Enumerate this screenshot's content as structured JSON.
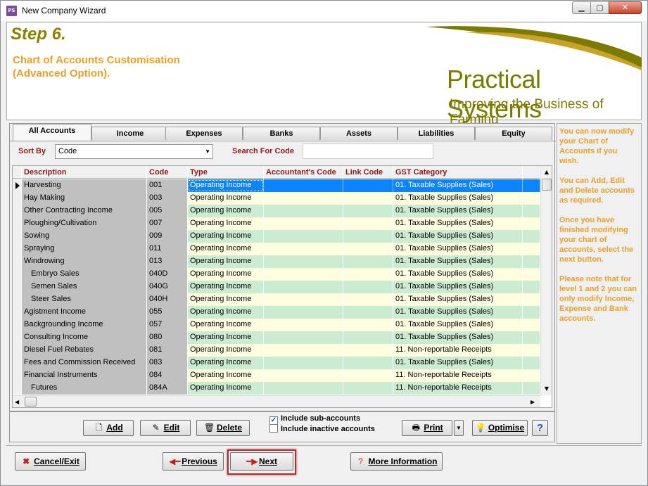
{
  "window": {
    "title": "New Company Wizard",
    "app_icon_text": "PS"
  },
  "header": {
    "step": "Step 6.",
    "subtitle_line1": "Chart of Accounts Customisation",
    "subtitle_line2": "(Advanced Option).",
    "brand_name": "Practical Systems",
    "brand_tagline": "Improving the Business of Farming",
    "brand_color": "#7b7b00",
    "accent_color": "#e8a02a"
  },
  "tabs": [
    "All Accounts",
    "Income",
    "Expenses",
    "Banks",
    "Assets",
    "Liabilities",
    "Equity"
  ],
  "active_tab": "All Accounts",
  "filters": {
    "sort_label": "Sort By",
    "sort_value": "Code",
    "search_label": "Search For Code",
    "search_value": ""
  },
  "grid": {
    "columns": [
      "Description",
      "Code",
      "Type",
      "Accountant's Code",
      "Link Code",
      "GST Category"
    ],
    "rows": [
      {
        "desc": "Harvesting",
        "code": "001",
        "type": "Operating Income",
        "acc": "",
        "link": "",
        "gst": "01. Taxable Supplies (Sales)",
        "sub": false
      },
      {
        "desc": "Hay Making",
        "code": "003",
        "type": "Operating Income",
        "acc": "",
        "link": "",
        "gst": "01. Taxable Supplies (Sales)",
        "sub": false
      },
      {
        "desc": "Other Contracting Income",
        "code": "005",
        "type": "Operating Income",
        "acc": "",
        "link": "",
        "gst": "01. Taxable Supplies (Sales)",
        "sub": false
      },
      {
        "desc": "Ploughing/Cultivation",
        "code": "007",
        "type": "Operating Income",
        "acc": "",
        "link": "",
        "gst": "01. Taxable Supplies (Sales)",
        "sub": false
      },
      {
        "desc": "Sowing",
        "code": "009",
        "type": "Operating Income",
        "acc": "",
        "link": "",
        "gst": "01. Taxable Supplies (Sales)",
        "sub": false
      },
      {
        "desc": "Spraying",
        "code": "011",
        "type": "Operating Income",
        "acc": "",
        "link": "",
        "gst": "01. Taxable Supplies (Sales)",
        "sub": false
      },
      {
        "desc": "Windrowing",
        "code": "013",
        "type": "Operating Income",
        "acc": "",
        "link": "",
        "gst": "01. Taxable Supplies (Sales)",
        "sub": false
      },
      {
        "desc": "Embryo Sales",
        "code": "040D",
        "type": "Operating Income",
        "acc": "",
        "link": "",
        "gst": "01. Taxable Supplies (Sales)",
        "sub": true
      },
      {
        "desc": "Semen Sales",
        "code": "040G",
        "type": "Operating Income",
        "acc": "",
        "link": "",
        "gst": "01. Taxable Supplies (Sales)",
        "sub": true
      },
      {
        "desc": "Steer Sales",
        "code": "040H",
        "type": "Operating Income",
        "acc": "",
        "link": "",
        "gst": "01. Taxable Supplies (Sales)",
        "sub": true
      },
      {
        "desc": "Agistment Income",
        "code": "055",
        "type": "Operating Income",
        "acc": "",
        "link": "",
        "gst": "01. Taxable Supplies (Sales)",
        "sub": false
      },
      {
        "desc": "Backgrounding Income",
        "code": "057",
        "type": "Operating Income",
        "acc": "",
        "link": "",
        "gst": "01. Taxable Supplies (Sales)",
        "sub": false
      },
      {
        "desc": "Consulting Income",
        "code": "080",
        "type": "Operating Income",
        "acc": "",
        "link": "",
        "gst": "01. Taxable Supplies (Sales)",
        "sub": false
      },
      {
        "desc": "Diesel Fuel Rebates",
        "code": "081",
        "type": "Operating Income",
        "acc": "",
        "link": "",
        "gst": "11. Non-reportable Receipts",
        "sub": false
      },
      {
        "desc": "Fees and Commission Received",
        "code": "083",
        "type": "Operating Income",
        "acc": "",
        "link": "",
        "gst": "01. Taxable Supplies (Sales)",
        "sub": false
      },
      {
        "desc": "Financial Instruments",
        "code": "084",
        "type": "Operating Income",
        "acc": "",
        "link": "",
        "gst": "11. Non-reportable Receipts",
        "sub": false
      },
      {
        "desc": "Futures",
        "code": "084A",
        "type": "Operating Income",
        "acc": "",
        "link": "",
        "gst": "11. Non-reportable Receipts",
        "sub": true
      }
    ],
    "selected_row": 0
  },
  "actions": {
    "add": "Add",
    "edit": "Edit",
    "delete": "Delete",
    "include_sub": "Include sub-accounts",
    "include_sub_checked": true,
    "include_inactive": "Include inactive accounts",
    "include_inactive_checked": false,
    "print": "Print",
    "optimise": "Optimise",
    "help": "?"
  },
  "help_panel": [
    "You can now modify your Chart of Accounts if you wish.",
    "You can Add, Edit and Delete accounts as required.",
    "Once you have finished modifying your chart of accounts, select the next button.",
    "Please note that for level 1 and 2 you can only modify Income, Expense and Bank accounts."
  ],
  "nav": {
    "cancel": "Cancel/Exit",
    "previous": "Previous",
    "next": "Next",
    "more_info": "More Information"
  }
}
